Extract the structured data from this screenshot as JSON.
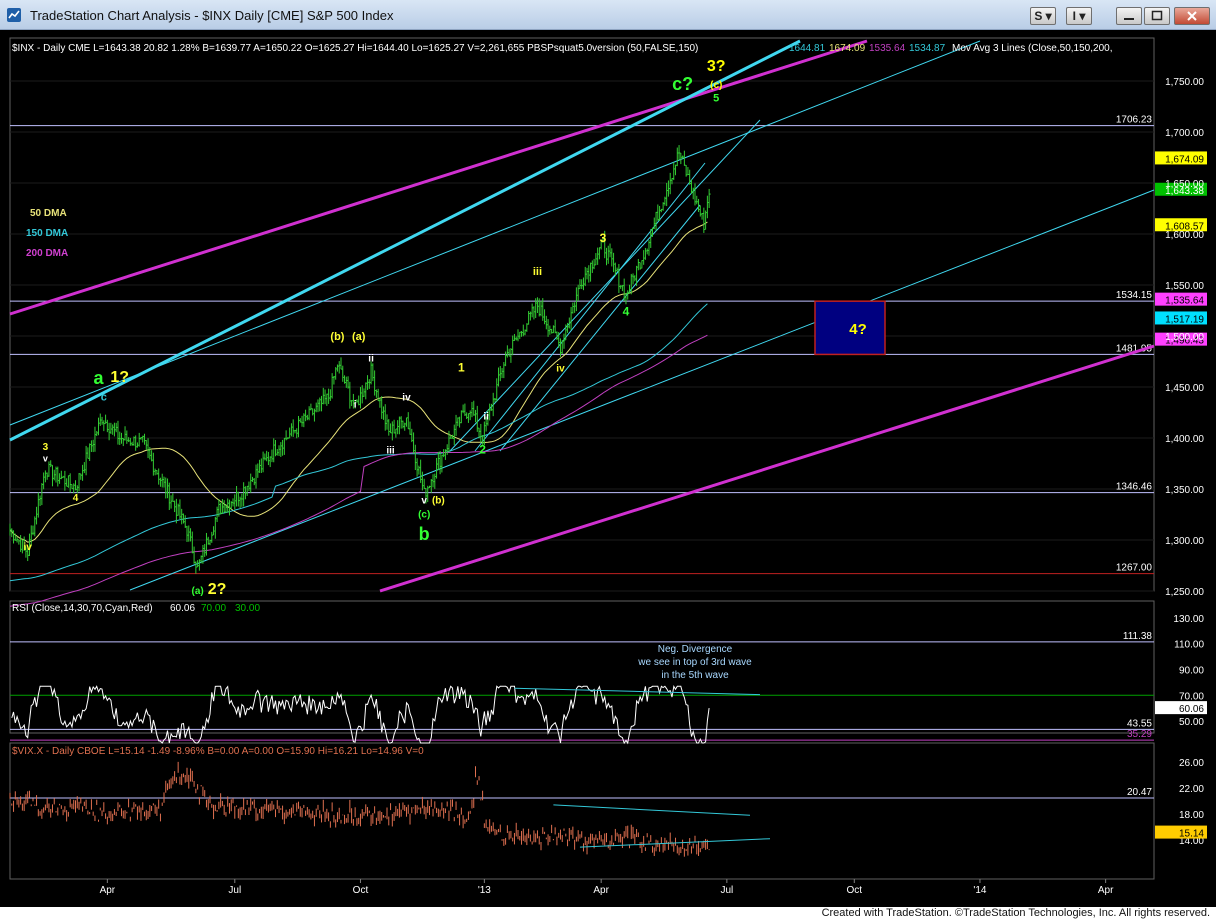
{
  "window": {
    "title": "TradeStation Chart Analysis - $INX Daily [CME] S&P 500 Index",
    "buttons": {
      "s_label": "S",
      "i_label": "I",
      "min_icon": "minimize-icon",
      "max_icon": "maximize-icon",
      "close_icon": "close-icon"
    }
  },
  "colors": {
    "background": "#000000",
    "price_bar": "#33cc33",
    "ma50": "#e8e37a",
    "ma150": "#33c8d8",
    "ma200": "#c040c0",
    "rsi": "#ffffff",
    "vix": "#e07050",
    "channel_magenta": "#d030d0",
    "channel_cyan": "#40d8f0",
    "box": "#000080"
  },
  "header": {
    "symbol_line": "$INX - Daily  CME  L=1643.38  20.82  1.28%  B=1639.77  A=1650.22  O=1625.27  Hi=1644.40  Lo=1625.27  V=2,261,655  PBSPsquat5.0version (50,FALSE,150)",
    "ma_values": [
      "1644.81",
      "1674.09",
      "1535.64",
      "1534.87"
    ],
    "ma_study": "Mov Avg 3 Lines (Close,50,150,200,"
  },
  "legend": {
    "ma50": "50 DMA",
    "ma150": "150 DMA",
    "ma200": "200 DMA"
  },
  "price_panel": {
    "ticks": [
      {
        "v": 1750,
        "label": "1,750.00"
      },
      {
        "v": 1700,
        "label": "1,700.00"
      },
      {
        "v": 1650,
        "label": "1,650.00"
      },
      {
        "v": 1600,
        "label": "1,600.00"
      },
      {
        "v": 1550,
        "label": "1,550.00"
      },
      {
        "v": 1500,
        "label": "1,500.00"
      },
      {
        "v": 1450,
        "label": "1,450.00"
      },
      {
        "v": 1400,
        "label": "1,400.00"
      },
      {
        "v": 1350,
        "label": "1,350.00"
      },
      {
        "v": 1300,
        "label": "1,300.00"
      },
      {
        "v": 1250,
        "label": "1,250.00"
      }
    ],
    "hlines": [
      {
        "v": 1706.23,
        "label": "1706.23",
        "color": "#c0c0ff"
      },
      {
        "v": 1534.15,
        "label": "1534.15",
        "color": "#c0c0ff"
      },
      {
        "v": 1481.95,
        "label": "1481.95",
        "color": "#c0c0ff"
      },
      {
        "v": 1346.46,
        "label": "1346.46",
        "color": "#c0c0ff"
      },
      {
        "v": 1267.0,
        "label": "1267.00",
        "color": "#c02020"
      }
    ],
    "badges": [
      {
        "v": 1674.09,
        "label": "1,674.09",
        "bg": "#ffff00",
        "fg": "#000"
      },
      {
        "v": 1643.38,
        "label": "1,643.38",
        "bg": "#00c000",
        "fg": "#fff"
      },
      {
        "v": 1608.57,
        "label": "1,608.57",
        "bg": "#ffff00",
        "fg": "#000"
      },
      {
        "v": 1535.64,
        "label": "1,535.64",
        "bg": "#ff40ff",
        "fg": "#000"
      },
      {
        "v": 1517.19,
        "label": "1,517.19",
        "bg": "#00e0ff",
        "fg": "#000"
      },
      {
        "v": 1496.43,
        "label": "1,496.43",
        "bg": "#ff40ff",
        "fg": "#000"
      }
    ],
    "target_box_label": "4?"
  },
  "wave_labels": [
    {
      "t": "c?",
      "d": 380,
      "v": 1741,
      "color": "#33ff33",
      "size": 18
    },
    {
      "t": "3?",
      "d": 399,
      "v": 1760,
      "color": "#ffff00",
      "size": 16
    },
    {
      "t": "(c)",
      "d": 399,
      "v": 1743,
      "color": "#ffff00",
      "size": 10
    },
    {
      "t": "5",
      "d": 399,
      "v": 1730,
      "color": "#33ff33",
      "size": 11
    },
    {
      "t": "3",
      "d": 335,
      "v": 1592,
      "color": "#ffff33",
      "size": 12
    },
    {
      "t": "iii",
      "d": 298,
      "v": 1560,
      "color": "#ffff33",
      "size": 11
    },
    {
      "t": "4",
      "d": 348,
      "v": 1520,
      "color": "#33ff33",
      "size": 12
    },
    {
      "t": "iv",
      "d": 311,
      "v": 1465,
      "color": "#ffff33",
      "size": 10
    },
    {
      "t": "1",
      "d": 255,
      "v": 1465,
      "color": "#ffff33",
      "size": 12
    },
    {
      "t": "2",
      "d": 267,
      "v": 1385,
      "color": "#33ff33",
      "size": 12
    },
    {
      "t": "ii",
      "d": 269,
      "v": 1418,
      "color": "#ffffff",
      "size": 10
    },
    {
      "t": "(b)",
      "d": 185,
      "v": 1496,
      "color": "#ffff33",
      "size": 11
    },
    {
      "t": "(a)",
      "d": 197,
      "v": 1496,
      "color": "#ffff33",
      "size": 11
    },
    {
      "t": "ii",
      "d": 204,
      "v": 1475,
      "color": "#ffffff",
      "size": 10
    },
    {
      "t": "i",
      "d": 195,
      "v": 1430,
      "color": "#ffffff",
      "size": 10
    },
    {
      "t": "iv",
      "d": 224,
      "v": 1437,
      "color": "#ffffff",
      "size": 10
    },
    {
      "t": "iii",
      "d": 215,
      "v": 1385,
      "color": "#ffffff",
      "size": 10
    },
    {
      "t": "v",
      "d": 234,
      "v": 1336,
      "color": "#ffffff",
      "size": 10
    },
    {
      "t": "(b)",
      "d": 242,
      "v": 1336,
      "color": "#ffff33",
      "size": 10
    },
    {
      "t": "(c)",
      "d": 234,
      "v": 1322,
      "color": "#33ff33",
      "size": 10
    },
    {
      "t": "b",
      "d": 234,
      "v": 1300,
      "color": "#33ff33",
      "size": 18
    },
    {
      "t": "a",
      "d": 50,
      "v": 1453,
      "color": "#33ff33",
      "size": 18
    },
    {
      "t": "1?",
      "d": 62,
      "v": 1455,
      "color": "#ffff33",
      "size": 16
    },
    {
      "t": "c",
      "d": 53,
      "v": 1437,
      "color": "#33c8d8",
      "size": 11
    },
    {
      "t": "3",
      "d": 20,
      "v": 1388,
      "color": "#ffff33",
      "size": 10
    },
    {
      "t": "v",
      "d": 20,
      "v": 1377,
      "color": "#ffffff",
      "size": 9
    },
    {
      "t": "4",
      "d": 37,
      "v": 1338,
      "color": "#ffff33",
      "size": 10
    },
    {
      "t": "iv",
      "d": 10,
      "v": 1290,
      "color": "#ffff33",
      "size": 10
    },
    {
      "t": "(a)",
      "d": 106,
      "v": 1247,
      "color": "#33ff33",
      "size": 10
    },
    {
      "t": "2?",
      "d": 117,
      "v": 1247,
      "color": "#ffff33",
      "size": 16
    }
  ],
  "x_axis": {
    "labels": [
      {
        "d": 55,
        "t": "Apr"
      },
      {
        "d": 127,
        "t": "Jul"
      },
      {
        "d": 198,
        "t": "Oct"
      },
      {
        "d": 268,
        "t": "'13"
      },
      {
        "d": 334,
        "t": "Apr"
      },
      {
        "d": 405,
        "t": "Jul"
      },
      {
        "d": 477,
        "t": "Oct"
      },
      {
        "d": 548,
        "t": "'14"
      },
      {
        "d": 619,
        "t": "Apr"
      }
    ]
  },
  "rsi_panel": {
    "header": "RSI (Close,14,30,70,Cyan,Red)",
    "values": [
      "60.06",
      "70.00",
      "30.00"
    ],
    "ticks": [
      {
        "v": 130,
        "label": "130.00"
      },
      {
        "v": 110,
        "label": "110.00"
      },
      {
        "v": 90,
        "label": "90.00"
      },
      {
        "v": 70,
        "label": "70.00"
      },
      {
        "v": 50,
        "label": "50.00"
      }
    ],
    "hlines": [
      {
        "v": 111.38,
        "label": "111.38"
      },
      {
        "v": 43.55,
        "label": "43.55"
      },
      {
        "v": 35.29,
        "label": "35.29"
      }
    ],
    "last_badge": "60.06",
    "annotation": [
      "Neg. Divergence",
      "we see in top of 3rd wave",
      "in the 5th wave"
    ]
  },
  "vix_panel": {
    "header": "$VIX.X - Daily  CBOE  L=15.14  -1.49  -8.96%  B=0.00  A=0.00  O=15.90  Hi=16.21  Lo=14.96  V=0",
    "ticks": [
      {
        "v": 26,
        "label": "26.00"
      },
      {
        "v": 22,
        "label": "22.00"
      },
      {
        "v": 18,
        "label": "18.00"
      },
      {
        "v": 14,
        "label": "14.00"
      }
    ],
    "hlines": [
      {
        "v": 20.47,
        "label": "20.47"
      }
    ],
    "last_badge": "15.14"
  },
  "footer": {
    "text": "Created with TradeStation. ©TradeStation Technologies, Inc. All rights reserved."
  }
}
